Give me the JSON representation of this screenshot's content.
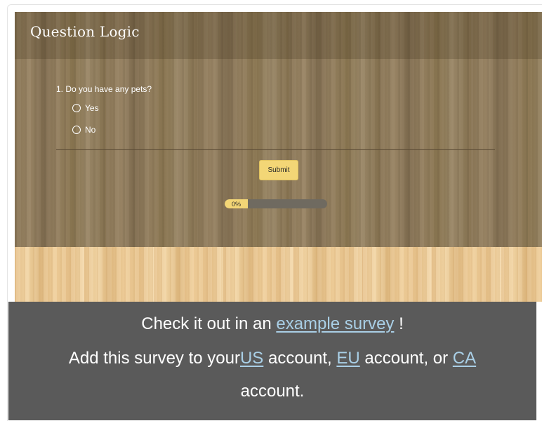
{
  "survey": {
    "title": "Question Logic",
    "question": "1. Do you have any pets?",
    "options": [
      {
        "label": "Yes",
        "selected": false
      },
      {
        "label": "No",
        "selected": false
      }
    ],
    "submit_label": "Submit",
    "progress": {
      "label": "0%",
      "value": 0
    }
  },
  "banner": {
    "line1_prefix": "Check it out in an ",
    "example_link": "example survey",
    "line1_suffix": " !",
    "line2_prefix": "Add this survey to your",
    "us_link": "US",
    "mid1": " account, ",
    "eu_link": "EU",
    "mid2": " account, or ",
    "ca_link": "CA",
    "line3": "account."
  },
  "colors": {
    "accent_yellow": "#f3d676",
    "banner_bg": "#5a5a5a",
    "link": "#a9cfe6",
    "progress_track": "#6f6a60"
  }
}
